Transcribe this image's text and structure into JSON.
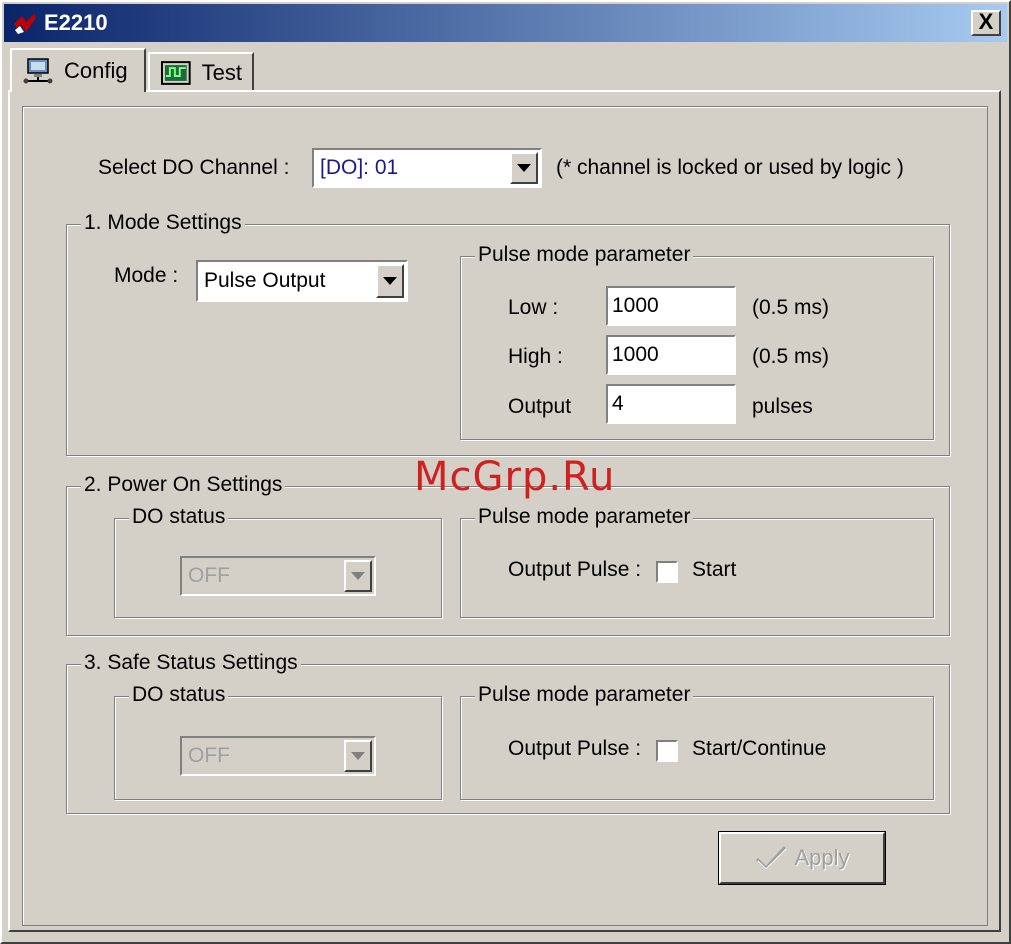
{
  "window": {
    "title": "E2210",
    "close_label": "X"
  },
  "tabs": [
    {
      "label": "Config",
      "icon": "network-computer-icon",
      "active": true
    },
    {
      "label": "Test",
      "icon": "oscilloscope-icon",
      "active": false
    }
  ],
  "channel": {
    "label": "Select DO Channel :",
    "value": "[DO]: 01",
    "note": "(* channel is locked or used by logic )"
  },
  "mode_settings": {
    "legend": "1. Mode Settings",
    "mode_label": "Mode :",
    "mode_value": "Pulse Output",
    "pulse": {
      "legend": "Pulse mode parameter",
      "low_label": "Low :",
      "low_value": "1000",
      "low_unit": "(0.5 ms)",
      "high_label": "High :",
      "high_value": "1000",
      "high_unit": "(0.5 ms)",
      "output_label": "Output",
      "output_value": "4",
      "output_unit": "pulses"
    }
  },
  "power_on": {
    "legend": "2. Power On Settings",
    "do_status_legend": "DO status",
    "do_status_value": "OFF",
    "pulse_legend": "Pulse mode parameter",
    "output_pulse_label": "Output Pulse :",
    "checkbox_label": "Start"
  },
  "safe_status": {
    "legend": "3. Safe Status Settings",
    "do_status_legend": "DO status",
    "do_status_value": "OFF",
    "pulse_legend": "Pulse mode parameter",
    "output_pulse_label": "Output Pulse :",
    "checkbox_label": "Start/Continue"
  },
  "apply_label": "Apply",
  "watermark": "McGrp.Ru"
}
